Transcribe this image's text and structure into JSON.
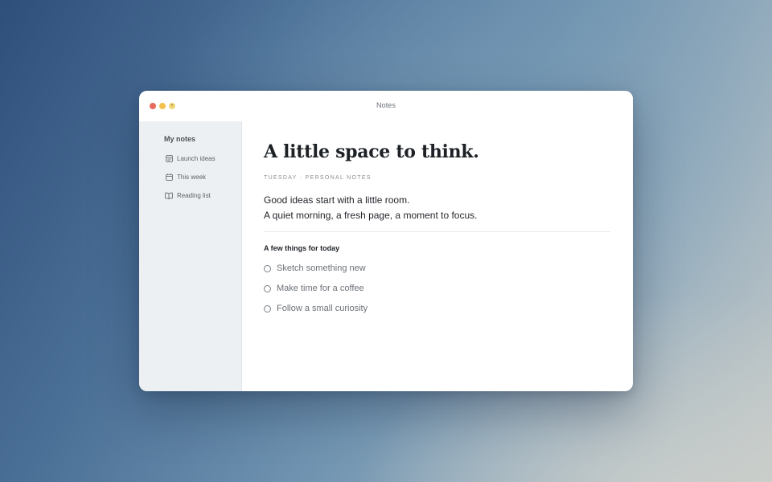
{
  "window": {
    "title": "Notes",
    "zoom_glyph": "+"
  },
  "sidebar": {
    "heading": "My notes",
    "items": [
      {
        "label": "Launch ideas",
        "icon": "note-icon"
      },
      {
        "label": "This week",
        "icon": "calendar-icon"
      },
      {
        "label": "Reading list",
        "icon": "book-icon"
      }
    ]
  },
  "note": {
    "title": "A little space to think.",
    "meta": "TUESDAY · PERSONAL NOTES",
    "intro": [
      "Good ideas start with a little room.",
      "A quiet morning, a fresh page, a moment to focus."
    ],
    "section_heading": "A few things for today",
    "todos": [
      {
        "label": "Sketch something new",
        "done": false
      },
      {
        "label": "Make time for a coffee",
        "done": false
      },
      {
        "label": "Follow a small curiosity",
        "done": false
      }
    ]
  },
  "colors": {
    "close": "#e86a5e",
    "minimize": "#f4c14f",
    "zoom": "#f2d77a",
    "sidebar_bg": "#edf0f2"
  }
}
